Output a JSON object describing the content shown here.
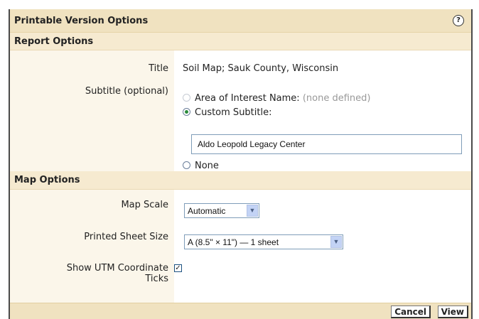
{
  "header": {
    "title": "Printable Version Options",
    "help_icon": "help-icon"
  },
  "report_options": {
    "section_title": "Report Options",
    "title_label": "Title",
    "title_value": "Soil Map; Sauk County, Wisconsin",
    "subtitle_label": "Subtitle (optional)",
    "subtitle_options": [
      {
        "label": "Area of Interest Name:",
        "suffix": "(none defined)",
        "checked": false,
        "disabled": true
      },
      {
        "label": "Custom Subtitle:",
        "checked": true,
        "disabled": false
      },
      {
        "label": "None",
        "checked": false,
        "disabled": false
      }
    ],
    "custom_subtitle_value": "Aldo Leopold Legacy Center"
  },
  "map_options": {
    "section_title": "Map Options",
    "map_scale_label": "Map Scale",
    "map_scale_value": "Automatic",
    "sheet_size_label": "Printed Sheet Size",
    "sheet_size_value": "A (8.5\" × 11\") — 1 sheet",
    "utm_label_line1": "Show UTM Coordinate",
    "utm_label_line2": "Ticks",
    "utm_checked": true
  },
  "footer": {
    "cancel_label": "Cancel",
    "view_label": "View"
  },
  "colors": {
    "header_bg": "#f0e2c0",
    "section_bg": "#f6ead0",
    "label_bg": "#fbf6ea"
  }
}
